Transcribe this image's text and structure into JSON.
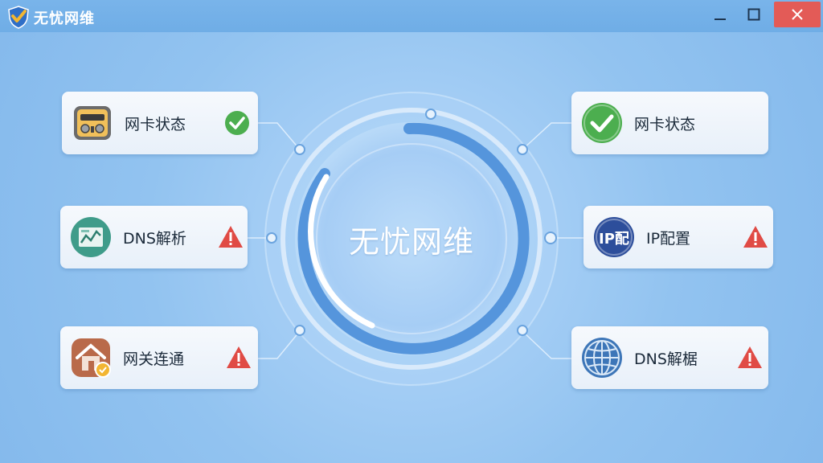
{
  "window": {
    "title": "无忧网维",
    "controls": {
      "minimize_icon": "minimize-icon",
      "maximize_icon": "maximize-icon",
      "close_icon": "close-icon",
      "close_color": "#e35b57"
    }
  },
  "center": {
    "title": "无忧网维",
    "progress_arc_color": "#5595dc"
  },
  "items": {
    "left": [
      {
        "label": "网卡状态",
        "icon": "network-card-icon",
        "status": "ok"
      },
      {
        "label": "DNS解析",
        "icon": "dns-chart-icon",
        "status": "warning"
      },
      {
        "label": "网关连通",
        "icon": "gateway-house-icon",
        "status": "warning"
      }
    ],
    "right": [
      {
        "label": "网卡状态",
        "icon": "check-circle-icon",
        "status": "none"
      },
      {
        "label": "IP配置",
        "icon": "ip-config-icon",
        "icon_text": "IP配",
        "status": "warning"
      },
      {
        "label": "DNS解椐",
        "icon": "globe-icon",
        "status": "warning"
      }
    ]
  },
  "colors": {
    "ok": "#4cae4f",
    "warning": "#e04b45",
    "accent": "#3f86d6"
  }
}
